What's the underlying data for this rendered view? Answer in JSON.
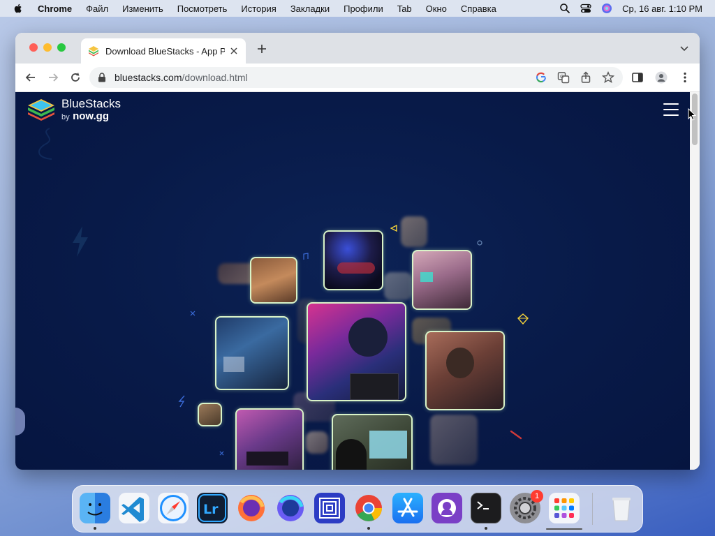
{
  "menubar": {
    "app_name": "Chrome",
    "items": [
      "Файл",
      "Изменить",
      "Посмотреть",
      "История",
      "Закладки",
      "Профили",
      "Tab",
      "Окно",
      "Справка"
    ],
    "datetime": "Ср, 16 авг. 1:10 PM"
  },
  "browser": {
    "tab_title": "Download BlueStacks - App Player",
    "url_domain": "bluestacks.com",
    "url_path": "/download.html"
  },
  "page": {
    "logo_name": "BlueStacks",
    "logo_by": "by",
    "logo_now": "now.gg"
  },
  "dock": {
    "apps": [
      "finder",
      "vscode",
      "safari",
      "lightroom",
      "firefox",
      "firefox-developer",
      "screens",
      "chrome",
      "app-store",
      "github-desktop",
      "terminal",
      "system-settings",
      "launchpad",
      "trash"
    ],
    "settings_badge": "1"
  },
  "colors": {
    "page_bg": "#081a48",
    "photo_border": "#d9f3c8",
    "accent_yellow": "#f5d33a"
  }
}
